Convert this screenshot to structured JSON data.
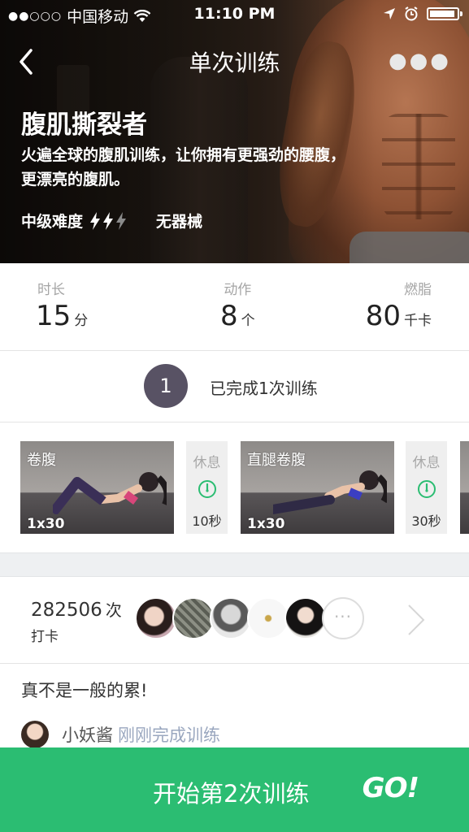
{
  "status_bar": {
    "carrier": "中国移动",
    "time": "11:10 PM",
    "battery_level": 0.95,
    "icons": [
      "signal-dots",
      "wifi-icon",
      "location-arrow-icon",
      "alarm-icon",
      "battery-icon"
    ]
  },
  "navbar": {
    "title": "单次训练",
    "back_icon": "chevron-left-icon",
    "more_icon": "more-dots-icon"
  },
  "workout": {
    "name": "腹肌撕裂者",
    "description": "火遍全球的腹肌训练，让你拥有更强劲的腰腹，更漂亮的腹肌。",
    "difficulty_label": "中级难度",
    "difficulty_level": 2,
    "difficulty_max": 3,
    "equipment": "无器械"
  },
  "stats": {
    "duration": {
      "label": "时长",
      "value": "15",
      "unit": "分"
    },
    "moves": {
      "label": "动作",
      "value": "8",
      "unit": "个"
    },
    "calories": {
      "label": "燃脂",
      "value": "80",
      "unit": "千卡"
    }
  },
  "completion": {
    "count": "1",
    "text": "已完成1次训练"
  },
  "exercises": [
    {
      "type": "exercise",
      "name": "卷腹",
      "reps": "1x30"
    },
    {
      "type": "rest",
      "label": "休息",
      "time": "10秒"
    },
    {
      "type": "exercise",
      "name": "直腿卷腹",
      "reps": "1x30"
    },
    {
      "type": "rest",
      "label": "休息",
      "time": "30秒"
    }
  ],
  "checkins": {
    "count": "282506",
    "count_unit": "次",
    "label": "打卡",
    "more_label": "···"
  },
  "feed": {
    "quote": "真不是一般的累!",
    "user": "小妖酱",
    "action": "刚刚完成训练"
  },
  "start_button": {
    "label": "开始第2次训练",
    "go": "GO!"
  },
  "colors": {
    "accent_green": "#2bbd72",
    "badge_purple": "#585264",
    "link_blue": "#9aa7bf"
  }
}
